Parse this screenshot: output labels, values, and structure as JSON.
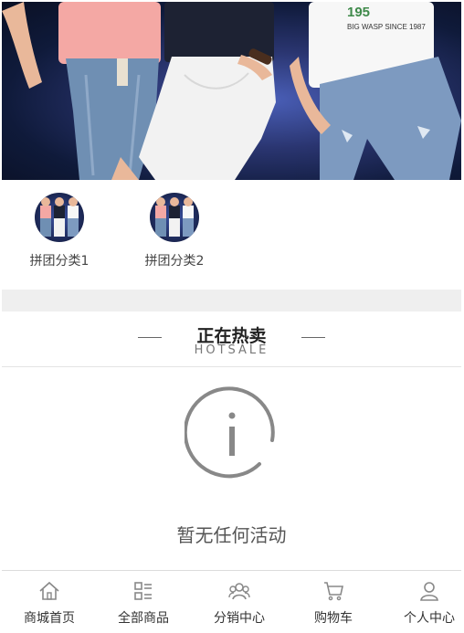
{
  "categories": [
    {
      "label": "拼团分类1",
      "icon": "kids-photo-thumbnail"
    },
    {
      "label": "拼团分类2",
      "icon": "kids-photo-thumbnail"
    }
  ],
  "section": {
    "title": "正在热卖",
    "subtitle": "HOTSALE"
  },
  "empty_state": {
    "icon": "info-icon",
    "message": "暂无任何活动"
  },
  "bottom_nav": [
    {
      "label": "商城首页",
      "icon": "home-icon"
    },
    {
      "label": "全部商品",
      "icon": "grid-list-icon"
    },
    {
      "label": "分销中心",
      "icon": "group-icon"
    },
    {
      "label": "购物车",
      "icon": "cart-icon"
    },
    {
      "label": "个人中心",
      "icon": "user-icon"
    }
  ],
  "banner": {
    "shirt_text": "BIG WASP SINCE 1987",
    "shirt_logo": "195"
  },
  "colors": {
    "gap_bg": "#efefef",
    "icon_gray": "#888888"
  }
}
